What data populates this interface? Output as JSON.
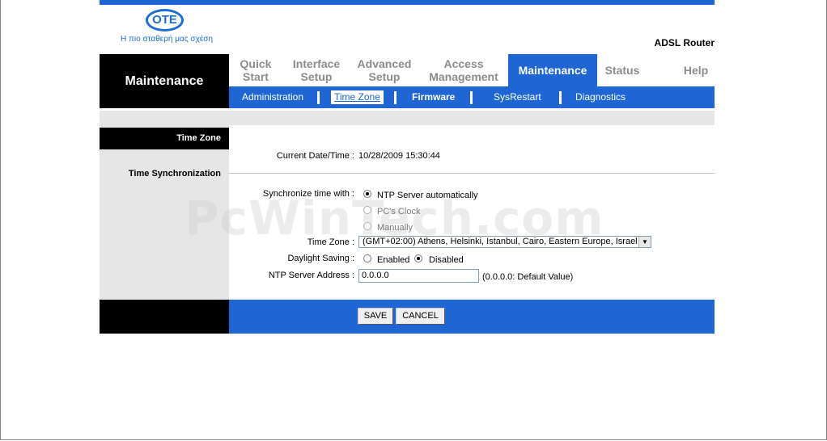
{
  "brand": {
    "logo_text": "OTE",
    "tagline": "Η πιο σταθερή μας σχέση",
    "product": "ADSL Router"
  },
  "header": {
    "section_title": "Maintenance"
  },
  "nav": {
    "items": [
      {
        "label_line1": "Quick",
        "label_line2": "Start"
      },
      {
        "label_line1": "Interface",
        "label_line2": "Setup"
      },
      {
        "label_line1": "Advanced",
        "label_line2": "Setup"
      },
      {
        "label_line1": "Access",
        "label_line2": "Management"
      },
      {
        "label_line1": "Maintenance",
        "label_line2": ""
      },
      {
        "label_line1": "Status",
        "label_line2": ""
      },
      {
        "label_line1": "Help",
        "label_line2": ""
      }
    ],
    "active": "Maintenance"
  },
  "subnav": {
    "items": [
      "Administration",
      "Time Zone",
      "Firmware",
      "SysRestart",
      "Diagnostics"
    ],
    "current": "Time Zone"
  },
  "sections": {
    "time_zone": "Time Zone",
    "time_sync": "Time Synchronization"
  },
  "form": {
    "current_datetime_label": "Current Date/Time :",
    "current_datetime_value": "10/28/2009 15:30:44",
    "sync_label": "Synchronize time with :",
    "sync_options": [
      "NTP Server automatically",
      "PC's Clock",
      "Manually"
    ],
    "sync_selected": "NTP Server automatically",
    "timezone_label": "Time Zone :",
    "timezone_value": "(GMT+02:00) Athens, Helsinki, Istanbul, Cairo, Eastern Europe, Israel",
    "daylight_label": "Daylight Saving :",
    "daylight_options": [
      "Enabled",
      "Disabled"
    ],
    "daylight_selected": "Disabled",
    "ntp_label": "NTP Server Address :",
    "ntp_value": "0.0.0.0",
    "ntp_hint": "(0.0.0.0: Default Value)"
  },
  "buttons": {
    "save": "SAVE",
    "cancel": "CANCEL"
  },
  "watermark": "PcWinTech.com",
  "colors": {
    "accent_blue": "#1f66d4",
    "nav_gray": "#8c8c8c",
    "panel_gray": "#e6e6e6"
  }
}
